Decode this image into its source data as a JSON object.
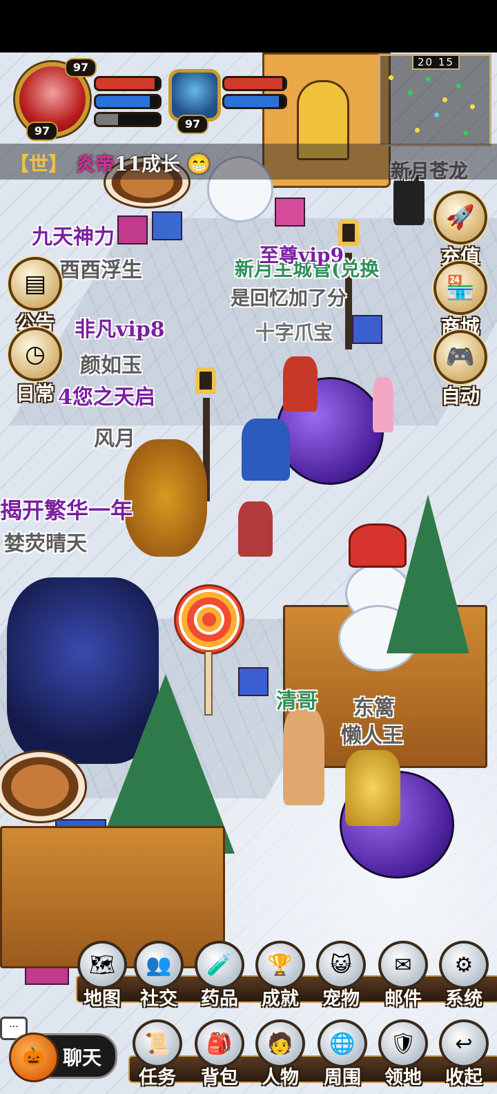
{
  "hud": {
    "player_level": "97",
    "player_level_top": "97",
    "pet_level": "97",
    "clock": "20 15",
    "world_chat": {
      "tag": "【世】",
      "sender": "炎帝",
      "message": "11成长"
    }
  },
  "side_buttons": [
    {
      "label": "公告",
      "icon": "notice-board-icon"
    },
    {
      "label": "日常",
      "icon": "clock-icon"
    },
    {
      "label": "充值",
      "icon": "rocket-icon"
    },
    {
      "label": "商城",
      "icon": "shop-icon"
    },
    {
      "label": "自动",
      "icon": "gamepad-icon"
    }
  ],
  "world_labels": {
    "l1": "九天神力",
    "l2": "酉酉浮生",
    "l3": "新月主城管(兑换",
    "l4": "至尊vip9",
    "l5": "是回忆加了分",
    "l6": "十字爪宝",
    "l7": "非凡vip8",
    "l8": "颜如玉",
    "l9": "4您之天启",
    "l10": "风月",
    "l11": "揭开繁华一年",
    "l12": "婪荧晴天",
    "l13": "清哥",
    "l14": "东篱",
    "l15": "懒人王",
    "l16": "新月苍龙"
  },
  "menu_top": [
    {
      "label": "地图",
      "icon": "map-icon"
    },
    {
      "label": "社交",
      "icon": "social-icon"
    },
    {
      "label": "药品",
      "icon": "potion-icon"
    },
    {
      "label": "成就",
      "icon": "trophy-icon"
    },
    {
      "label": "宠物",
      "icon": "pet-icon"
    },
    {
      "label": "邮件",
      "icon": "mail-icon"
    },
    {
      "label": "系统",
      "icon": "gear-icon"
    }
  ],
  "menu_bottom": [
    {
      "label": "任务",
      "icon": "quest-book-icon"
    },
    {
      "label": "背包",
      "icon": "backpack-icon"
    },
    {
      "label": "人物",
      "icon": "character-icon"
    },
    {
      "label": "周围",
      "icon": "nearby-icon"
    },
    {
      "label": "领地",
      "icon": "territory-icon"
    },
    {
      "label": "收起",
      "icon": "collapse-icon"
    }
  ],
  "chat_button": {
    "label": "聊天",
    "bubble": "..."
  },
  "player": {
    "hp": 0.92,
    "mp": 0.85,
    "xp": 0.35
  },
  "pet": {
    "hp": 0.95,
    "mp": 0.9
  }
}
